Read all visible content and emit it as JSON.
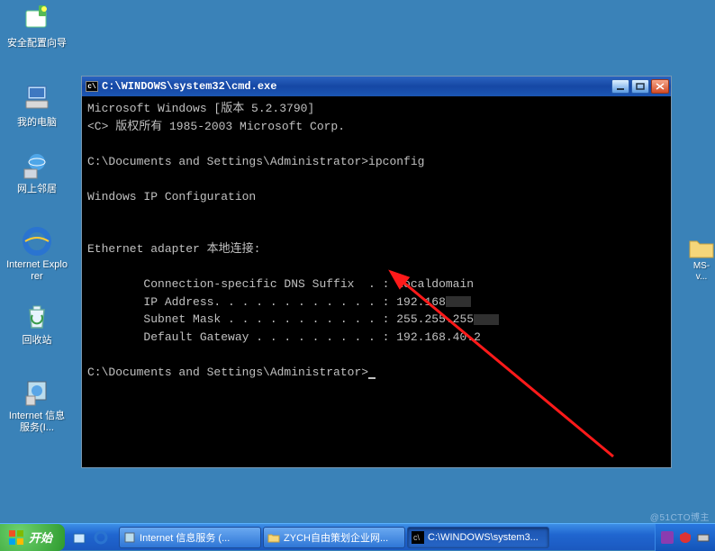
{
  "desktop": {
    "icons": [
      {
        "label": "安全配置向导"
      },
      {
        "label": "我的电脑"
      },
      {
        "label": "网上邻居"
      },
      {
        "label": "Internet Explorer"
      },
      {
        "label": "回收站"
      },
      {
        "label": "Internet 信息服务(I..."
      }
    ],
    "folder_right": {
      "label": "MS-v..."
    }
  },
  "cmd": {
    "title": "C:\\WINDOWS\\system32\\cmd.exe",
    "lines": {
      "l1": "Microsoft Windows [版本 5.2.3790]",
      "l2": "<C> 版权所有 1985-2003 Microsoft Corp.",
      "l3": "C:\\Documents and Settings\\Administrator>ipconfig",
      "l4": "Windows IP Configuration",
      "l5": "Ethernet adapter 本地连接:",
      "l6": "        Connection-specific DNS Suffix  . : localdomain",
      "l7a": "        IP Address. . . . . . . . . . . . : 192.168",
      "l8a": "        Subnet Mask . . . . . . . . . . . : 255.255.255",
      "l9": "        Default Gateway . . . . . . . . . : 192.168.40.2",
      "l10": "C:\\Documents and Settings\\Administrator>"
    },
    "controls": {
      "min": "minimize",
      "max": "maximize",
      "close": "close"
    }
  },
  "taskbar": {
    "start": "开始",
    "quicklaunch": [
      "desktop",
      "ie"
    ],
    "tasks": [
      {
        "label": "Internet 信息服务 (...",
        "active": false
      },
      {
        "label": "ZYCH自由策划企业网...",
        "active": false
      },
      {
        "label": "C:\\WINDOWS\\system3...",
        "active": true
      }
    ],
    "tray": {
      "im": "",
      "sec": "",
      "keys": "",
      "time": ""
    },
    "watermark": "@51CTO博主"
  },
  "icons": {
    "wizard": "wizard-icon",
    "computer": "my-computer-icon",
    "network": "network-places-icon",
    "ie": "ie-icon",
    "recycle": "recycle-bin-icon",
    "iis": "iis-icon",
    "folder": "folder-icon",
    "cmd": "cmd-icon"
  }
}
